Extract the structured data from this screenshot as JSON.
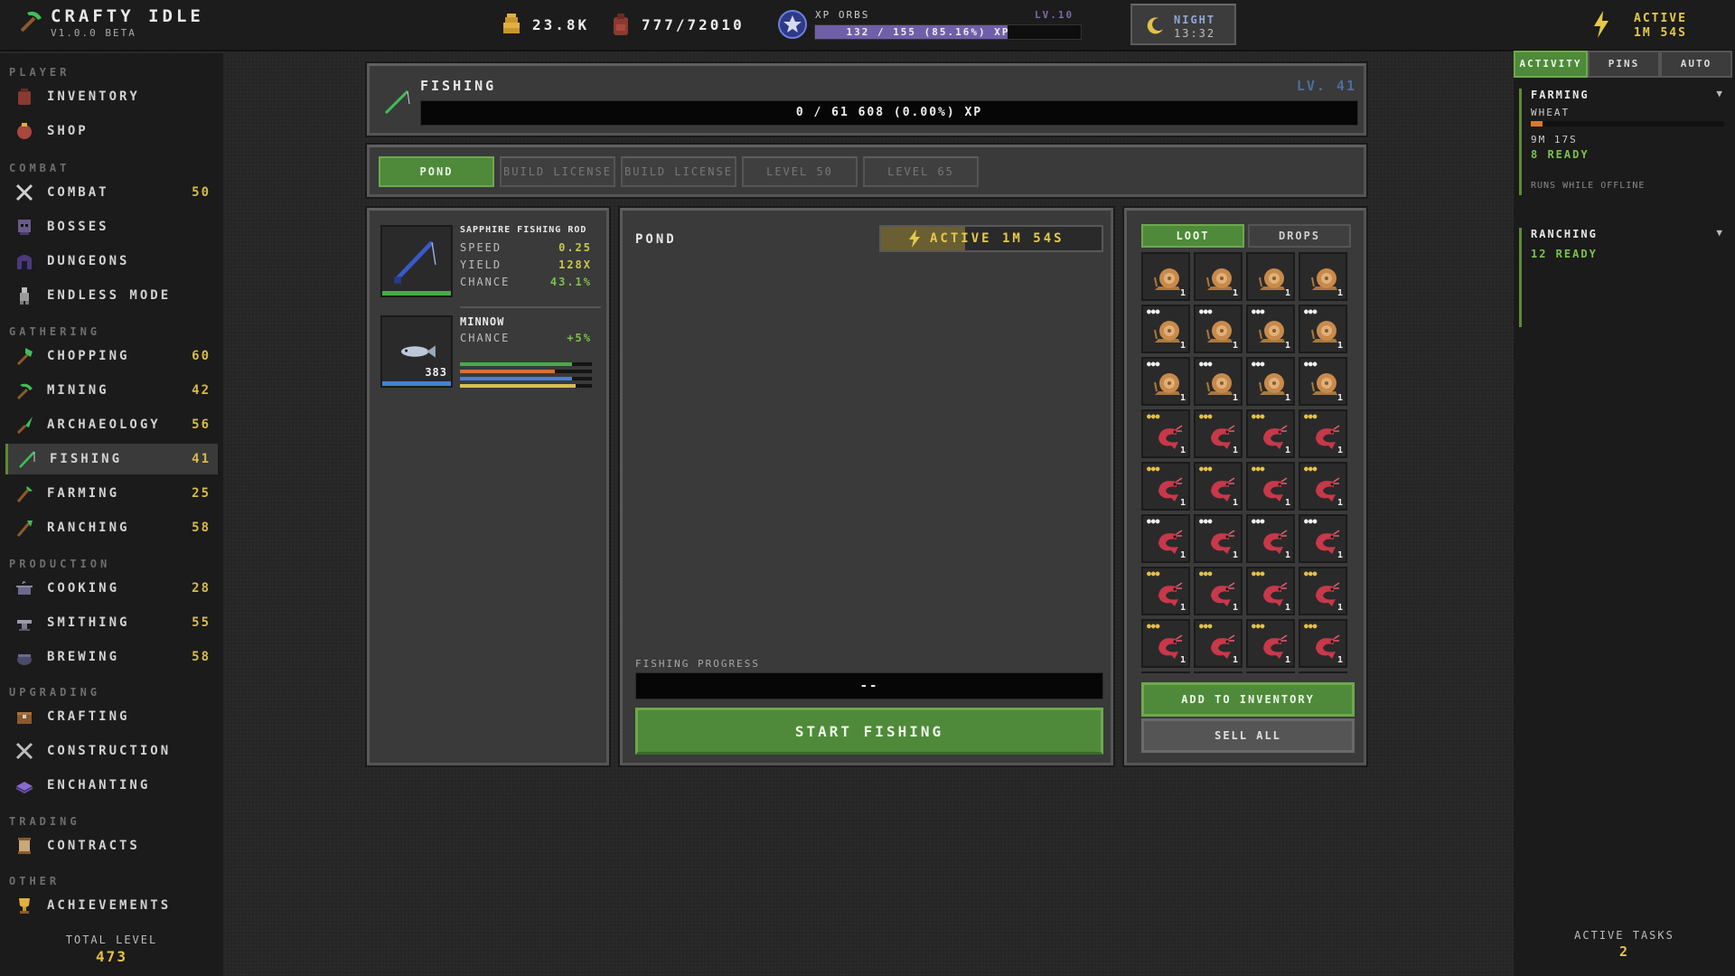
{
  "app": {
    "title": "CRAFTY IDLE",
    "version": "V1.0.0 BETA"
  },
  "topbar": {
    "gold": "23.8K",
    "inventory": "777/72010",
    "xp_orbs": {
      "label": "XP ORBS",
      "level": "LV.10",
      "text": "132 / 155 (85.16%) XP",
      "progress": 0.8516
    },
    "time": {
      "label": "NIGHT",
      "clock": "13:32"
    },
    "active": {
      "label": "ACTIVE",
      "time": "1M 54S"
    }
  },
  "sidebar": {
    "sections": {
      "player": "PLAYER",
      "combat": "COMBAT",
      "gathering": "GATHERING",
      "production": "PRODUCTION",
      "upgrading": "UPGRADING",
      "trading": "TRADING",
      "other": "OTHER"
    },
    "items": [
      {
        "label": "INVENTORY",
        "level": ""
      },
      {
        "label": "SHOP",
        "level": ""
      },
      {
        "label": "COMBAT",
        "level": "50"
      },
      {
        "label": "BOSSES",
        "level": ""
      },
      {
        "label": "DUNGEONS",
        "level": ""
      },
      {
        "label": "ENDLESS MODE",
        "level": ""
      },
      {
        "label": "CHOPPING",
        "level": "60"
      },
      {
        "label": "MINING",
        "level": "42"
      },
      {
        "label": "ARCHAEOLOGY",
        "level": "56"
      },
      {
        "label": "FISHING",
        "level": "41"
      },
      {
        "label": "FARMING",
        "level": "25"
      },
      {
        "label": "RANCHING",
        "level": "58"
      },
      {
        "label": "COOKING",
        "level": "28"
      },
      {
        "label": "SMITHING",
        "level": "55"
      },
      {
        "label": "BREWING",
        "level": "58"
      },
      {
        "label": "CRAFTING",
        "level": ""
      },
      {
        "label": "CONSTRUCTION",
        "level": ""
      },
      {
        "label": "ENCHANTING",
        "level": ""
      },
      {
        "label": "CONTRACTS",
        "level": ""
      },
      {
        "label": "ACHIEVEMENTS",
        "level": ""
      }
    ],
    "total_level_label": "TOTAL LEVEL",
    "total_level": "473"
  },
  "skill": {
    "name": "FISHING",
    "level": "LV. 41",
    "xp_text": "0 / 61 608 (0.00%) XP",
    "xp_progress": 0.0
  },
  "areas": [
    {
      "label": "POND",
      "selected": true
    },
    {
      "label": "BUILD LICENSE",
      "selected": false
    },
    {
      "label": "BUILD LICENSE",
      "selected": false
    },
    {
      "label": "LEVEL 50",
      "selected": false
    },
    {
      "label": "LEVEL 65",
      "selected": false
    }
  ],
  "gear": {
    "rod": {
      "name": "SAPPHIRE FISHING ROD",
      "stats": [
        {
          "label": "SPEED",
          "value": "0.25"
        },
        {
          "label": "YIELD",
          "value": "128X"
        },
        {
          "label": "CHANCE",
          "value": "43.1%"
        }
      ]
    },
    "bait": {
      "name": "MINNOW",
      "count": "383",
      "chance_label": "CHANCE",
      "chance_value": "+5%",
      "bars": [
        {
          "color": "#4aa84a",
          "fill": 0.85
        },
        {
          "color": "#d8703a",
          "fill": 0.72
        },
        {
          "color": "#4a7fd0",
          "fill": 0.85
        },
        {
          "color": "#d8c04a",
          "fill": 0.88
        }
      ]
    }
  },
  "main": {
    "title": "POND",
    "activity": "ACTIVE 1M 54S",
    "activity_progress": 0.38,
    "progress_label": "FISHING PROGRESS",
    "progress_text": "--",
    "start_label": "START FISHING"
  },
  "loot": {
    "tabs": [
      "LOOT",
      "DROPS"
    ],
    "rows": [
      {
        "kind": "snail",
        "stars": "",
        "qty": "1"
      },
      {
        "kind": "snail",
        "stars": "white",
        "qty": "1"
      },
      {
        "kind": "snail",
        "stars": "white",
        "qty": "1"
      },
      {
        "kind": "shrimp",
        "stars": "gold",
        "qty": "1"
      },
      {
        "kind": "shrimp",
        "stars": "gold",
        "qty": "1"
      },
      {
        "kind": "shrimp",
        "stars": "white",
        "qty": "1"
      },
      {
        "kind": "shrimp",
        "stars": "gold",
        "qty": "1"
      },
      {
        "kind": "shrimp",
        "stars": "gold",
        "qty": "1"
      },
      {
        "kind": "shrimp",
        "stars": "white",
        "qty": ""
      }
    ],
    "add_label": "ADD TO INVENTORY",
    "sell_label": "SELL ALL"
  },
  "right": {
    "tabs": [
      "ACTIVITY",
      "PINS",
      "AUTO"
    ],
    "tasks": [
      {
        "name": "FARMING",
        "sub": "WHEAT",
        "progress": 0.06,
        "time": "9M 17S",
        "ready": "8 READY",
        "note": "RUNS WHILE OFFLINE"
      },
      {
        "name": "RANCHING",
        "ready": "12 READY"
      }
    ],
    "active_tasks_label": "ACTIVE TASKS",
    "active_tasks": "2"
  },
  "colors": {
    "accent_green": "#4e8a3a",
    "gold": "#e3c14a",
    "xp_purple": "#6f5fa8"
  }
}
